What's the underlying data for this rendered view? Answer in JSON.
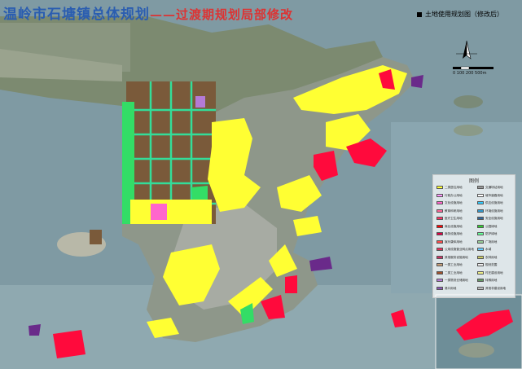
{
  "title": {
    "main": "温岭市石塘镇总体规划",
    "sub": "——过渡期规划局部修改"
  },
  "caption": "土地使用规划图（修改后）",
  "scale": {
    "ticks": "0  100 200       500m"
  },
  "legend": {
    "title": "图例",
    "items": [
      {
        "label": "二类居住用地",
        "color": "#ffff33"
      },
      {
        "label": "行政办公用地",
        "color": "#ff99ff"
      },
      {
        "label": "文化设施用地",
        "color": "#ff66cc"
      },
      {
        "label": "教育科研用地",
        "color": "#ff6699"
      },
      {
        "label": "医疗卫生用地",
        "color": "#ff3366"
      },
      {
        "label": "商业设施用地",
        "color": "#ff0000"
      },
      {
        "label": "商务设施用地",
        "color": "#dd0044"
      },
      {
        "label": "娱乐康体用地",
        "color": "#ff4d4d"
      },
      {
        "label": "公用设施营业网点用地",
        "color": "#e8305a"
      },
      {
        "label": "其他服务设施用地",
        "color": "#cc3366"
      },
      {
        "label": "一类工业用地",
        "color": "#c8a07a"
      },
      {
        "label": "二类工业用地",
        "color": "#a0522d"
      },
      {
        "label": "一类物流仓储用地",
        "color": "#b47ad6"
      },
      {
        "label": "港口用地",
        "color": "#8a5ab6"
      },
      {
        "label": "交通场站用地",
        "color": "#999999"
      },
      {
        "label": "城市道路用地",
        "color": "#ffffff"
      },
      {
        "label": "供应设施用地",
        "color": "#33ccff"
      },
      {
        "label": "环境设施用地",
        "color": "#3399cc"
      },
      {
        "label": "安全设施用地",
        "color": "#336699"
      },
      {
        "label": "公园绿地",
        "color": "#33cc33"
      },
      {
        "label": "防护绿地",
        "color": "#66ff99"
      },
      {
        "label": "广场用地",
        "color": "#99cc99"
      },
      {
        "label": "水域",
        "color": "#66ccff"
      },
      {
        "label": "农林用地",
        "color": "#cccc66"
      },
      {
        "label": "规划范围",
        "color": "#eeeeee"
      },
      {
        "label": "村庄建设用地",
        "color": "#eeee88"
      },
      {
        "label": "特殊用地",
        "color": "#669966"
      },
      {
        "label": "其他非建设用地",
        "color": "#bbbbbb"
      }
    ]
  },
  "colors": {
    "sea": "#7f9aa3",
    "residential": "#ffff33",
    "industrial": "#7a5a3a",
    "commercial": "#ff0a3c",
    "green": "#33dd66",
    "port": "#6a2a8a",
    "title": "#2a5db0"
  }
}
